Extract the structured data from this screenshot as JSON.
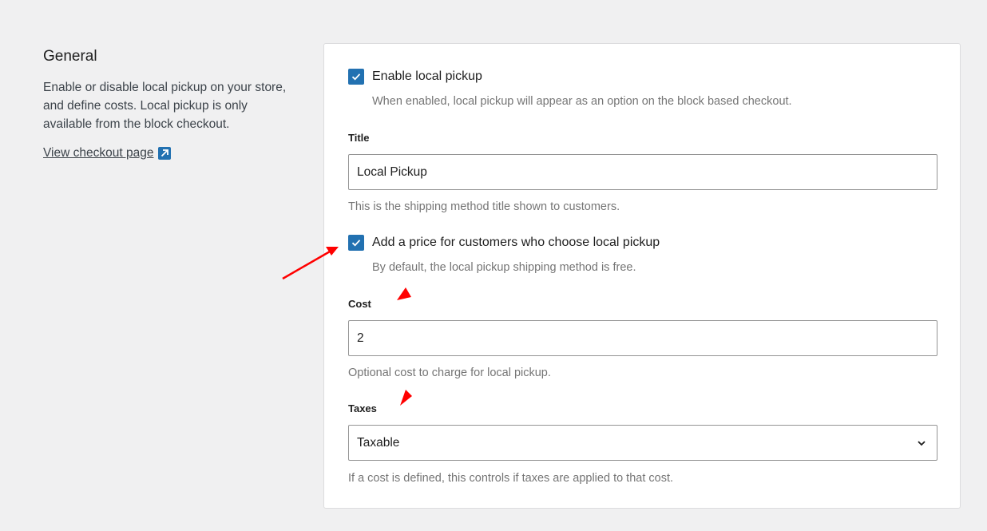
{
  "intro": {
    "title": "General",
    "description": "Enable or disable local pickup on your store, and define costs. Local pickup is only available from the block checkout.",
    "link_text": "View checkout page"
  },
  "settings": {
    "enable_pickup": {
      "label": "Enable local pickup",
      "checked": true,
      "help": "When enabled, local pickup will appear as an option on the block based checkout."
    },
    "title_field": {
      "label": "Title",
      "value": "Local Pickup",
      "help": "This is the shipping method title shown to customers."
    },
    "add_price": {
      "label": "Add a price for customers who choose local pickup",
      "checked": true,
      "help": "By default, the local pickup shipping method is free."
    },
    "cost_field": {
      "label": "Cost",
      "value": "2",
      "help": "Optional cost to charge for local pickup."
    },
    "taxes_field": {
      "label": "Taxes",
      "value": "Taxable",
      "help": "If a cost is defined, this controls if taxes are applied to that cost."
    }
  },
  "colors": {
    "accent": "#2271b1",
    "annotation": "#ff0000",
    "background": "#f0f0f1",
    "card": "#ffffff"
  },
  "icons": [
    "external-link-icon",
    "checkmark-icon",
    "chevron-down-icon",
    "annotation-arrow-icon"
  ]
}
